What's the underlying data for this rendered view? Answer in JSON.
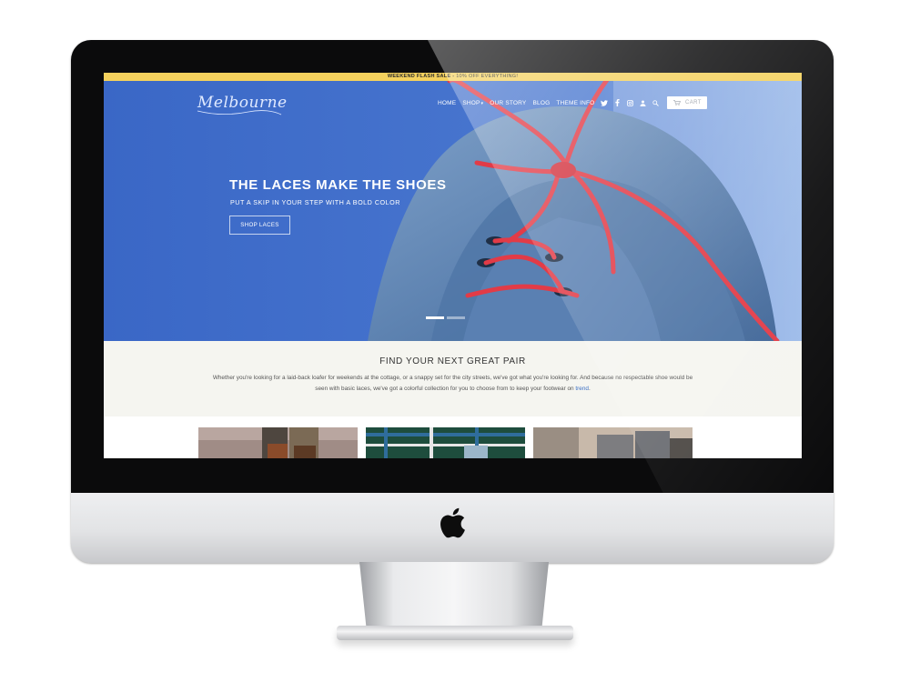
{
  "promo": {
    "bold": "WEEKEND FLASH SALE -",
    "text": " 10% OFF EVERYTHING!"
  },
  "brand": {
    "logo_text": "Melbourne"
  },
  "nav": {
    "items": [
      {
        "label": "HOME"
      },
      {
        "label": "SHOP",
        "has_dropdown": true
      },
      {
        "label": "OUR STORY"
      },
      {
        "label": "BLOG"
      },
      {
        "label": "THEME INFO"
      }
    ],
    "icons": [
      "twitter-icon",
      "facebook-icon",
      "instagram-icon",
      "account-icon",
      "search-icon"
    ],
    "cart_label": "CART"
  },
  "hero": {
    "title": "THE LACES MAKE THE SHOES",
    "subtitle": "PUT A SKIP IN YOUR STEP WITH A BOLD COLOR",
    "button_label": "SHOP LACES",
    "slide_count": 2,
    "active_slide": 1
  },
  "intro": {
    "title": "FIND YOUR NEXT GREAT PAIR",
    "body": "Whether you're looking for a laid-back loafer for weekends at the cottage, or a snappy set for the city streets, we've got what you're looking for. And because no respectable shoe would be seen with basic laces, we've got a colorful collection for you to choose from to keep your footwear on ",
    "link_text": "trend",
    "end": "."
  },
  "colors": {
    "accent": "#3a6fc4",
    "promo_bar": "#f4d15d",
    "hero_bg": "#3e6fcb",
    "lace_red": "#e23b47",
    "intro_bg": "#f5f5f0"
  }
}
